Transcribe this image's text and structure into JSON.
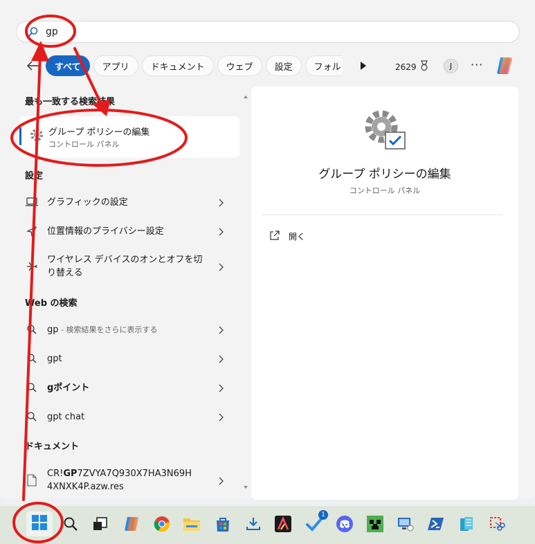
{
  "search": {
    "value": "gp",
    "placeholder": ""
  },
  "filters": {
    "all": "すべて",
    "apps": "アプリ",
    "documents": "ドキュメント",
    "web": "ウェブ",
    "settings": "設定",
    "folders": "フォル"
  },
  "header": {
    "points": "2629",
    "avatar_initial": "J"
  },
  "best_match": {
    "title": "最も一致する検索結果",
    "item_title": "グループ ポリシーの編集",
    "item_sub": "コントロール パネル"
  },
  "settings": {
    "title": "設定",
    "items": [
      {
        "label": "グラフィックの設定"
      },
      {
        "label": "位置情報のプライバシー設定"
      },
      {
        "label": "ワイヤレス デバイスのオンとオフを切り替える"
      }
    ]
  },
  "web": {
    "title": "Web の検索",
    "items": [
      {
        "label": "gp",
        "sub": " - 検索結果をさらに表示する"
      },
      {
        "label": "gpt"
      },
      {
        "label": "gポイント"
      },
      {
        "label": "gpt chat"
      }
    ]
  },
  "documents": {
    "title": "ドキュメント",
    "items": [
      {
        "pre": "CR!",
        "bold": "GP",
        "post": "7ZVYA7Q930X7HA3N69H4XNXK4P.azw.res"
      }
    ]
  },
  "preview": {
    "title": "グループ ポリシーの編集",
    "sub": "コントロール パネル",
    "open": "開く"
  },
  "taskbar": {
    "todo_badge": "1"
  },
  "colors": {
    "accent": "#1766c1",
    "annotation": "#e31b1b",
    "taskbar": "#dfe6dc"
  }
}
